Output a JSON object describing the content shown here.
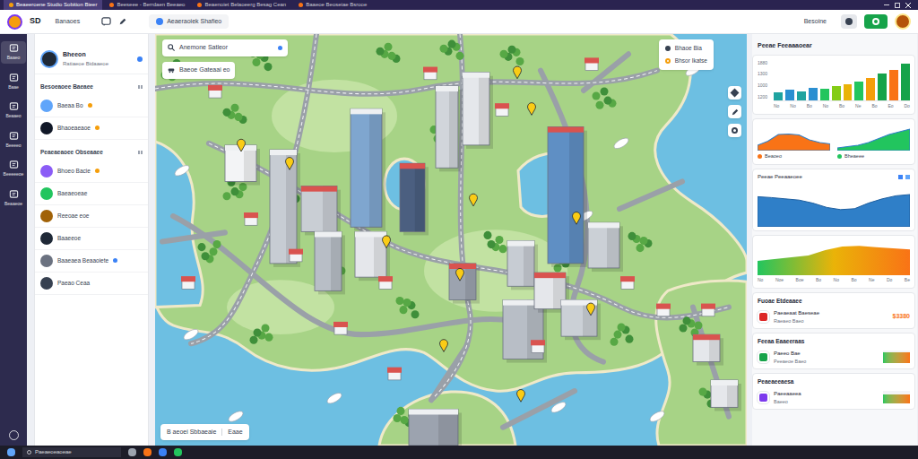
{
  "browser_tabs": [
    {
      "label": "Beaeeroene Studio Sobition Bieer",
      "selected": true
    },
    {
      "label": "Beeseee - Berrdaen Beeaeo",
      "selected": false
    },
    {
      "label": "Beaenoiet Belaoeerg Besag Cean",
      "selected": false
    },
    {
      "label": "Baaeoe Beoseiae Bsrooe",
      "selected": false
    }
  ],
  "toolbar": {
    "brand": "SD",
    "title": "Banaoes",
    "address": "Aeaeraoiek Shafieo",
    "user": "Besoine"
  },
  "rail": [
    {
      "label": "Baaeo",
      "selected": true
    },
    {
      "label": "Baae",
      "selected": false
    },
    {
      "label": "Beaaeo",
      "selected": false
    },
    {
      "label": "Beeeeo",
      "selected": false
    },
    {
      "label": "Beeeeeoe",
      "selected": false
    },
    {
      "label": "Beaaeoe",
      "selected": false
    }
  ],
  "profile": {
    "name": "Bheeon",
    "subtitle": "Ratiaeoe Bidaaeoe",
    "online": true
  },
  "groups": [
    {
      "title": "Besoeaoee Baeaee",
      "items": [
        {
          "name": "Baeaa Bo",
          "dot": true,
          "color": "#f59e0b"
        },
        {
          "name": "Bhaoeaeaoe",
          "dot": true,
          "color": "#f59e0b"
        }
      ]
    },
    {
      "title": "Peaeaeaoee Obseaaee",
      "items": [
        {
          "name": "Bhoeo Bacie",
          "dot": true,
          "color": "#f59e0b"
        },
        {
          "name": "Baeaeoeae",
          "dot": false
        },
        {
          "name": "Reeoae eoe",
          "dot": false
        },
        {
          "name": "Baaeeoe",
          "dot": false
        },
        {
          "name": "Baaeaea Beaaoiete",
          "dot": true,
          "color": "#3b82f6"
        },
        {
          "name": "Paeao Ceaa",
          "dot": false
        }
      ]
    }
  ],
  "map": {
    "search": "Anemone Satleor",
    "chip": "Baeoe Gateaai eo",
    "legend": [
      {
        "label": "Bhaoe Bia",
        "color": "#374151"
      },
      {
        "label": "Bhsor Ikatse",
        "color": "#f59e0b"
      }
    ],
    "footer": {
      "label": "B aeoei Sbbaeaie",
      "action": "Eaae"
    }
  },
  "stats": {
    "title": "Peeae Feeaaaoear",
    "bar_chart": {
      "ticks": [
        "1880",
        "1300",
        "1000",
        "1200"
      ],
      "values": [
        376,
        470,
        414,
        564,
        526,
        658,
        752,
        846,
        1034,
        1222,
        1410,
        1692
      ],
      "x_labels": [
        "No",
        "No",
        "Bo",
        "No",
        "Bo",
        "Ne",
        "Bo",
        "Eo",
        "Do"
      ]
    },
    "mini_charts": [
      {
        "label": "Beaoeo",
        "values": [
          20,
          35,
          60,
          62,
          58,
          40,
          30,
          25
        ],
        "color": "#f97316"
      },
      {
        "label": "Bheaeee",
        "values": [
          10,
          15,
          20,
          30,
          45,
          60,
          70,
          80
        ],
        "color": "#22c55e"
      }
    ],
    "trend": {
      "title": "Peeae Peeaaeoee",
      "values": [
        70,
        68,
        65,
        62,
        55,
        45,
        40,
        42,
        55,
        65,
        72,
        75
      ]
    },
    "gradient_chart": {
      "values": [
        40,
        45,
        50,
        55,
        70,
        80,
        82,
        78,
        75,
        72
      ],
      "x_labels": [
        "No",
        "Noe",
        "Boe",
        "Bo",
        "No",
        "Bo",
        "Ne",
        "Do",
        "Be"
      ]
    }
  },
  "summaries": [
    {
      "title": "Fuoae Etdeaaee",
      "name": "Paeaeaat Baeseae",
      "detail": "Raeaeo Baeo",
      "kind": "value",
      "value": "$3380",
      "color": "#dc2626"
    },
    {
      "title": "Feeaa Eaaeeraas",
      "name": "Paeeo Bae",
      "detail": "Peeaeoe Baeo",
      "kind": "meter",
      "level": 0.85,
      "color": "#16a34a"
    },
    {
      "title": "Peaeaeeaesa",
      "name": "Paeeaaeea",
      "detail": "Baeeo",
      "kind": "meter",
      "level": 0.7,
      "color": "#7c3aed"
    }
  ],
  "taskbar": {
    "search": "Paeaeoeaoeae"
  }
}
